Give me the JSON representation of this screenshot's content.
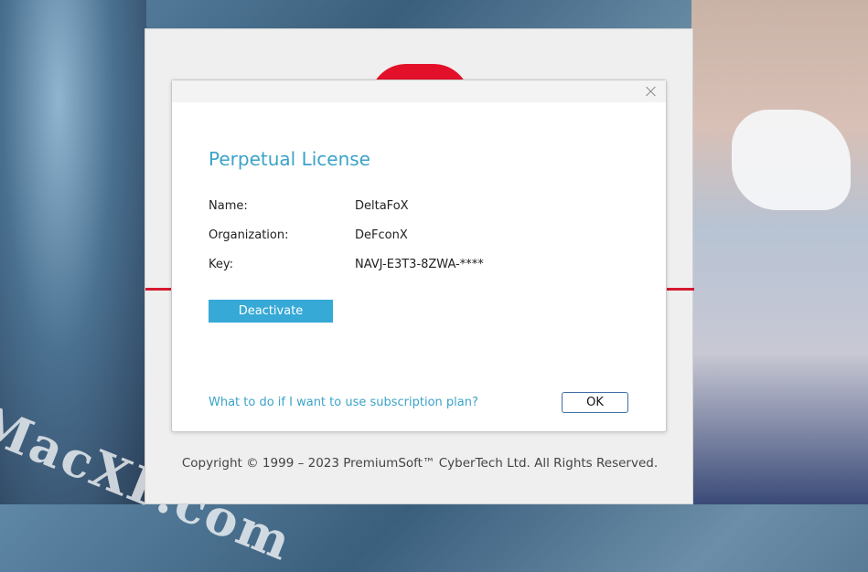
{
  "background": {
    "watermark": "MacXF.com"
  },
  "about_window": {
    "copyright": "Copyright © 1999 – 2023 PremiumSoft™ CyberTech Ltd. All Rights Reserved."
  },
  "license_dialog": {
    "title": "Perpetual License",
    "fields": [
      {
        "label": "Name:",
        "value": "DeltaFoX"
      },
      {
        "label": "Organization:",
        "value": "DeFconX"
      },
      {
        "label": "Key:",
        "value": "NAVJ-E3T3-8ZWA-****"
      }
    ],
    "deactivate_label": "Deactivate",
    "subscription_link": "What to do if I want to use subscription plan?",
    "ok_label": "OK"
  },
  "colors": {
    "accent": "#3ba3c8",
    "button": "#36a9d7",
    "brand_red": "#e3102a"
  },
  "icons": {
    "close": "close-icon"
  }
}
